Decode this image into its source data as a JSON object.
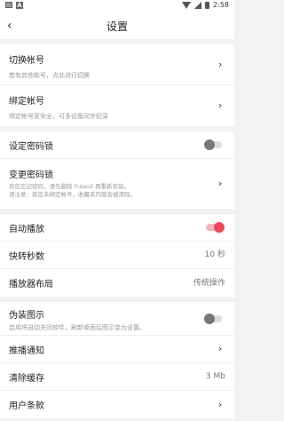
{
  "status_bar": {
    "time": "2:58"
  },
  "header": {
    "title": "设置"
  },
  "account": {
    "switch_label": "切换帐号",
    "switch_desc": "若有其他帐号，点此进行切换",
    "bind_label": "绑定帐号",
    "bind_desc": "绑定帐号更安全，可多设备同步纪录"
  },
  "lock": {
    "set_label": "设定密码锁",
    "change_label": "变更密码锁",
    "change_desc_1": "若您忘记密码，请先删除 Fulao2 再重新安装。",
    "change_desc_2": "请注意：若您未绑定帐号，收藏夹内容会被清除。"
  },
  "player": {
    "autoplay_label": "自动播放",
    "skip_label": "快转秒数",
    "skip_value": "10 秒",
    "layout_label": "播放器布局",
    "layout_value": "传统操作"
  },
  "misc": {
    "disguise_label": "伪装图示",
    "disguise_desc": "启用将自动关闭软件，刷新桌面后图示变为设置。",
    "push_label": "推播通知",
    "cache_label": "清除缓存",
    "cache_value": "3 Mb",
    "terms_label": "用户条款"
  },
  "toggles": {
    "set_lock": false,
    "autoplay": true,
    "disguise": false
  },
  "colors": {
    "accent": "#e94a5b"
  }
}
